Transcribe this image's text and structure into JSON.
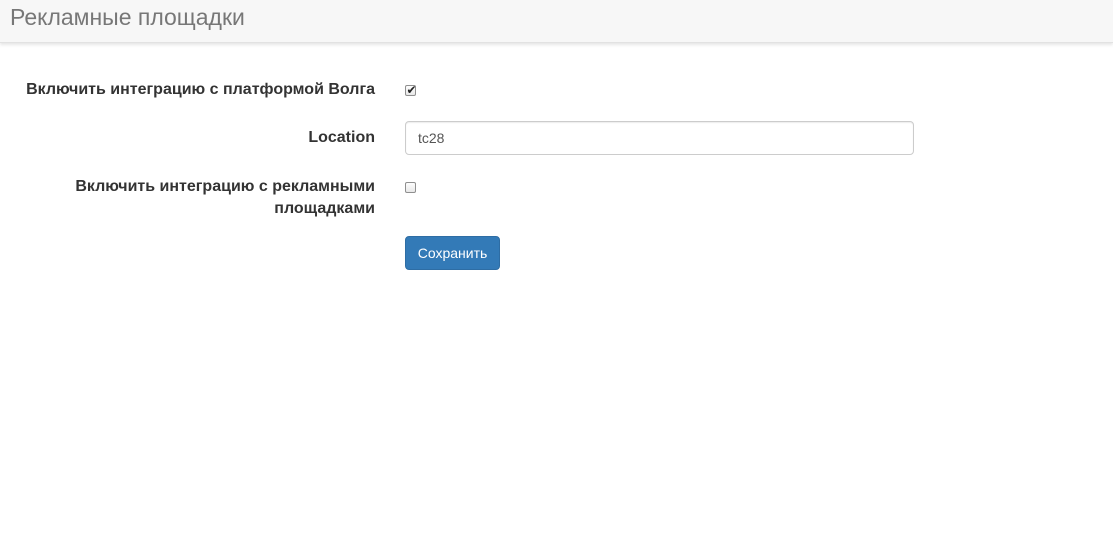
{
  "header": {
    "title": "Рекламные площадки"
  },
  "form": {
    "volga_integration": {
      "label": "Включить интеграцию с платформой Волга",
      "checked": true
    },
    "location": {
      "label": "Location",
      "value": "tc28"
    },
    "ad_integration": {
      "label_line1": "Включить интеграцию с рекламными",
      "label_line2": "площадками",
      "checked": false
    },
    "save_label": "Сохранить"
  },
  "colors": {
    "primary": "#337ab7",
    "header_bg": "#f7f7f7",
    "title": "#777777"
  }
}
